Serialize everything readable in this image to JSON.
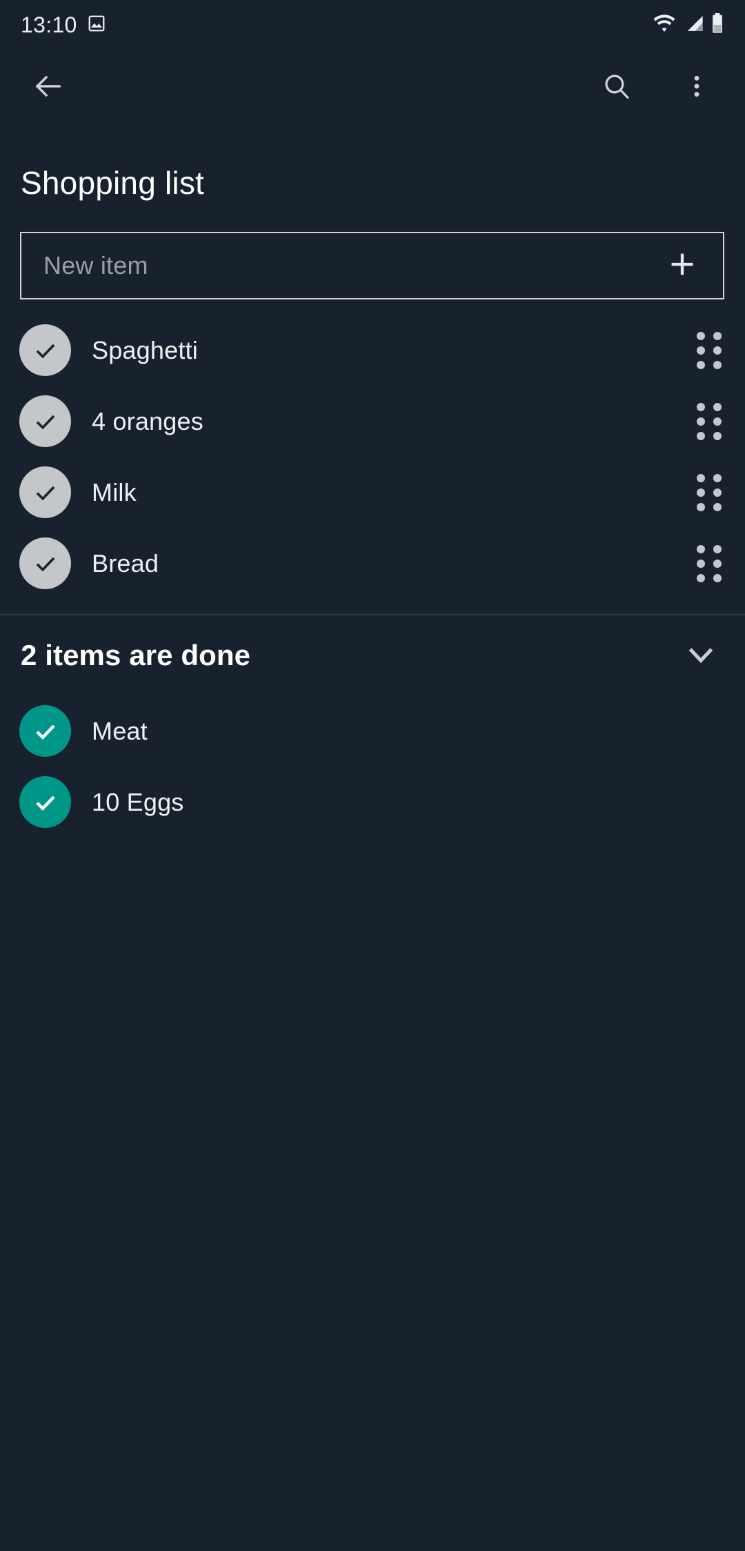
{
  "statusbar": {
    "time": "13:10",
    "icons": [
      "image-icon",
      "wifi-icon",
      "cellular-signal-icon",
      "battery-icon"
    ]
  },
  "toolbar": {
    "back_icon": "back-arrow-icon",
    "search_icon": "search-icon",
    "overflow_icon": "more-vertical-icon"
  },
  "page": {
    "title": "Shopping list"
  },
  "new_item": {
    "placeholder": "New item",
    "value": "",
    "add_icon": "plus-icon"
  },
  "pending_items": [
    {
      "label": "Spaghetti",
      "checked": false
    },
    {
      "label": "4 oranges",
      "checked": false
    },
    {
      "label": "Milk",
      "checked": false
    },
    {
      "label": "Bread",
      "checked": false
    }
  ],
  "done_section": {
    "header": "2 items are done",
    "count": 2,
    "collapse_icon": "chevron-down-icon",
    "expanded": true,
    "items": [
      {
        "label": "Meat",
        "checked": true
      },
      {
        "label": "10 Eggs",
        "checked": true
      }
    ]
  },
  "colors": {
    "background": "#18222e",
    "accent_teal": "#009688",
    "pending_circle": "#c3c7ca",
    "text_primary": "#eef1f3",
    "text_placeholder": "#97a0aa",
    "divider": "#2d3744"
  }
}
